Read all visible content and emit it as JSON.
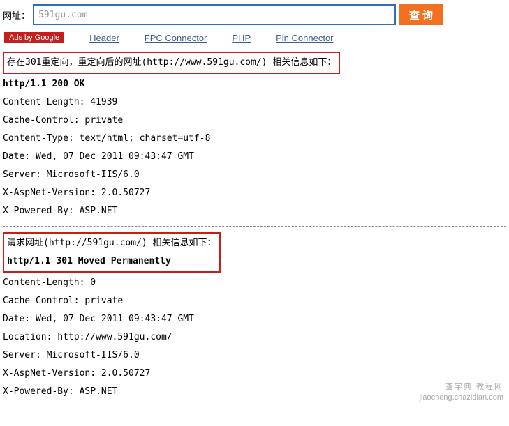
{
  "search": {
    "label": "网址：",
    "value": "591gu.com",
    "button": "查询"
  },
  "ads": {
    "badge": "Ads by Google",
    "links": [
      "Header",
      "FPC Connector",
      "PHP",
      "Pin Connector"
    ]
  },
  "section1": {
    "title": "存在301重定向，重定向后的网址(http://www.591gu.com/) 相关信息如下：",
    "status": "http/1.1 200 OK",
    "headers": [
      "Content-Length: 41939",
      "Cache-Control: private",
      "Content-Type: text/html; charset=utf-8",
      "Date: Wed, 07 Dec 2011 09:43:47 GMT",
      "Server: Microsoft-IIS/6.0",
      "X-AspNet-Version: 2.0.50727",
      "X-Powered-By: ASP.NET"
    ]
  },
  "section2": {
    "title": "请求网址(http://591gu.com/) 相关信息如下：",
    "status": "http/1.1 301 Moved Permanently",
    "headers": [
      "Content-Length: 0",
      "Cache-Control: private",
      "Date: Wed, 07 Dec 2011 09:43:47 GMT",
      "Location: http://www.591gu.com/",
      "Server: Microsoft-IIS/6.0",
      "X-AspNet-Version: 2.0.50727",
      "X-Powered-By: ASP.NET"
    ]
  },
  "watermark": {
    "cn": "查字典 教程网",
    "url": "jiaocheng.chazidian.com"
  }
}
